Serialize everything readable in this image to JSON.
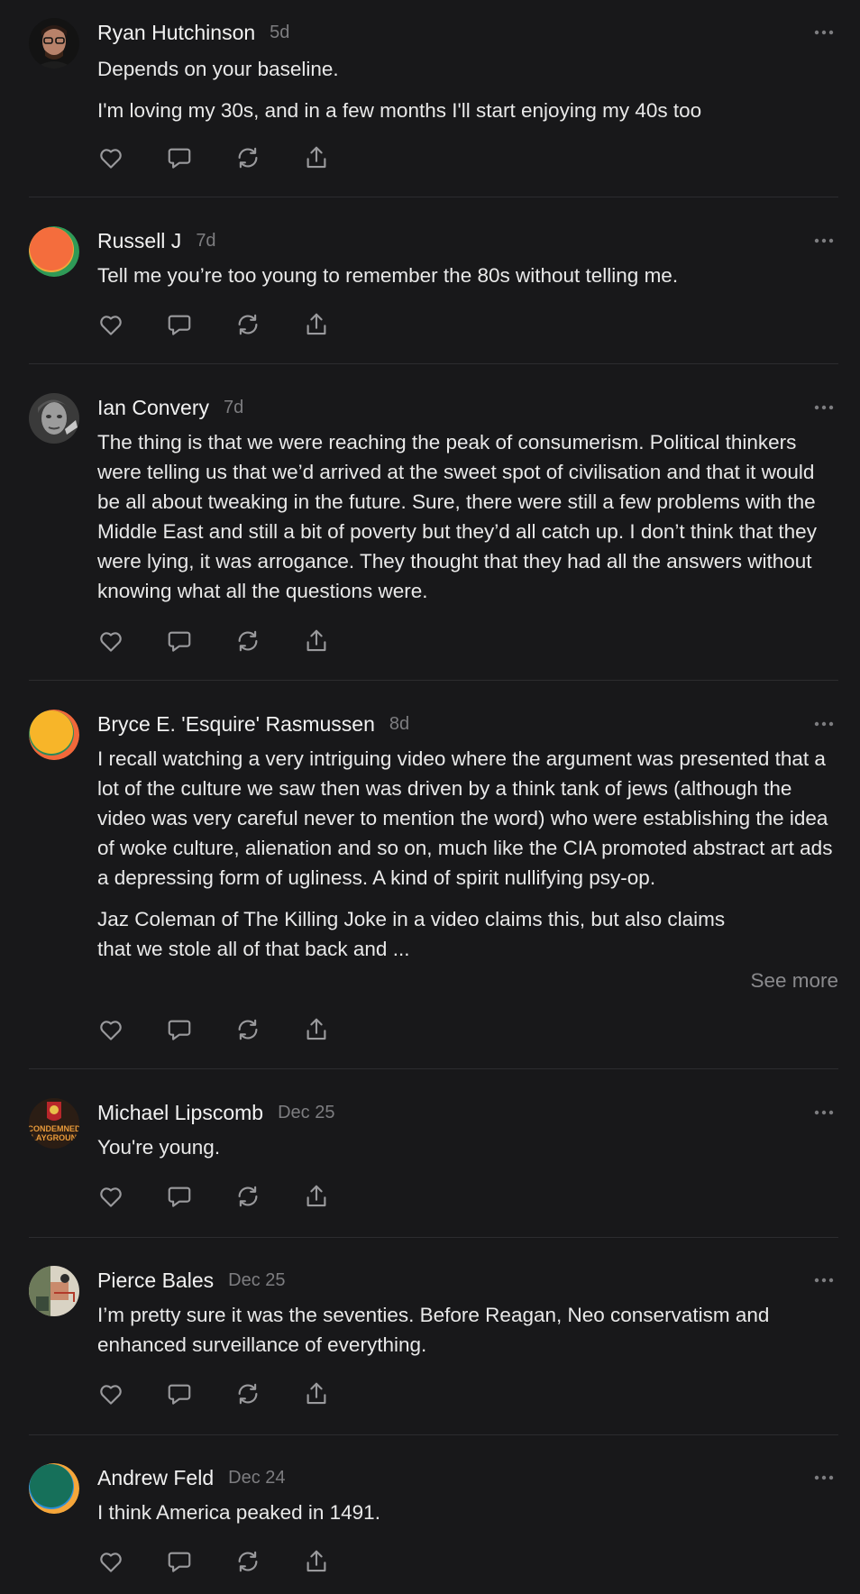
{
  "feed": {
    "comments": [
      {
        "name": "Ryan Hutchinson",
        "time": "5d",
        "avatar": "photo-avatar-man-glasses",
        "paragraphs": [
          "Depends on your baseline.",
          "I'm loving my 30s, and in a few months I'll start enjoying my 40s too"
        ]
      },
      {
        "name": "Russell J",
        "time": "7d",
        "avatar": "orange-gradient-avatar",
        "paragraphs": [
          "Tell me you’re too young to remember the 80s without telling me."
        ]
      },
      {
        "name": "Ian Convery",
        "time": "7d",
        "avatar": "photo-avatar-grayscale",
        "paragraphs": [
          "The thing is that we were reaching the peak of consumerism. Political thinkers were telling us that we’d arrived at the sweet spot of civilisation and that it would be all about tweaking in the future. Sure, there were still a few problems with the Middle East and still a bit of poverty but they’d all catch up. I don’t think that they were lying, it was arrogance. They thought that they had all the answers without knowing what all the questions were."
        ]
      },
      {
        "name": "Bryce E. 'Esquire' Rasmussen",
        "time": "8d",
        "avatar": "yellow-gradient-avatar",
        "paragraphs": [
          "I recall watching a very intriguing video where the argument was presented that a lot of the culture we saw then was driven by a think tank of jews (although the video was very careful never to mention the word) who were establishing the idea of woke culture, alienation and so on, much like the CIA promoted abstract art ads a depressing form of ugliness. A kind of spirit nullifying psy-op.",
          "Jaz Coleman of The Killing Joke in a video claims this, but also claims that we stole all of that back and ..."
        ],
        "see_more": "See more"
      },
      {
        "name": "Michael Lipscomb",
        "time": "Dec 25",
        "avatar": "logo-avatar-condemned-playground",
        "avatar_text": [
          "CONDEMNED",
          "PLAYGROUND"
        ],
        "paragraphs": [
          "You're young."
        ]
      },
      {
        "name": "Pierce Bales",
        "time": "Dec 25",
        "avatar": "artwork-avatar",
        "paragraphs": [
          "I’m pretty sure it was the seventies. Before Reagan, Neo conservatism and enhanced surveillance of everything."
        ]
      },
      {
        "name": "Andrew Feld",
        "time": "Dec 24",
        "avatar": "teal-gradient-avatar",
        "paragraphs": [
          "I think America peaked in 1491."
        ]
      }
    ]
  },
  "icons": {
    "more": "more-horizontal-icon",
    "like": "heart-icon",
    "reply": "comment-bubble-icon",
    "repost": "repost-icon",
    "share": "share-icon"
  },
  "colors": {
    "background": "#18181a",
    "text": "#ececec",
    "muted": "#7d7d80",
    "divider": "#2c2c2f"
  }
}
